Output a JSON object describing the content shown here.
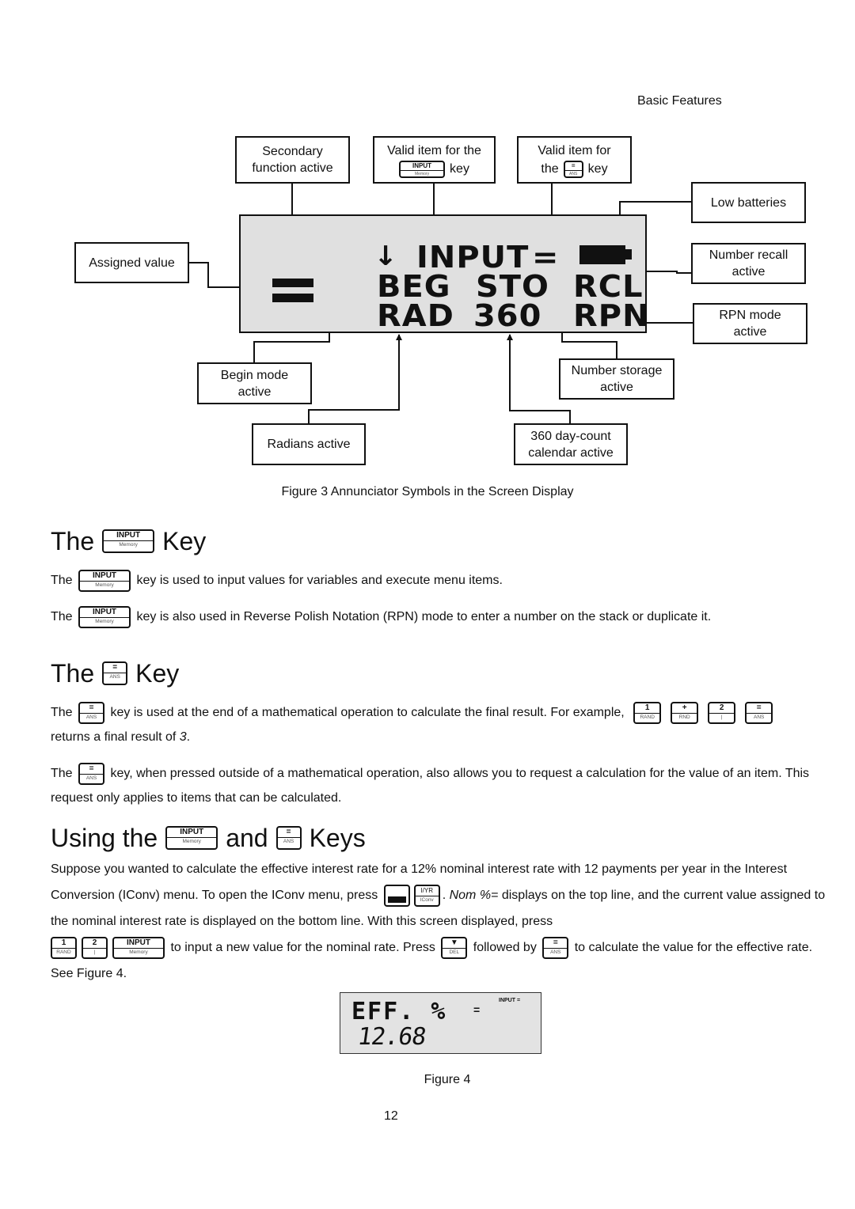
{
  "running_head": "Basic Features",
  "figure3": {
    "callouts": {
      "secondary": [
        "Secondary",
        "function active"
      ],
      "valid_input": {
        "line1": "Valid item for the",
        "suffix": "key"
      },
      "valid_equals": {
        "line1": "Valid item for",
        "prefix": "the",
        "suffix": "key"
      },
      "low_batteries": "Low batteries",
      "assigned_value": "Assigned value",
      "number_recall": [
        "Number recall",
        "active"
      ],
      "rpn_mode": [
        "RPN mode",
        "active"
      ],
      "begin_mode": [
        "Begin mode",
        "active"
      ],
      "number_storage": [
        "Number storage",
        "active"
      ],
      "radians": "Radians active",
      "day360": [
        "360 day-count",
        "calendar active"
      ]
    },
    "lcd": {
      "row1": {
        "arrow": "↓",
        "input": "INPUT",
        "equals": "="
      },
      "row2": {
        "beg": "BEG",
        "sto": "STO",
        "rcl": "RCL"
      },
      "row3": {
        "rad": "RAD",
        "n360": "360",
        "rpn": "RPN"
      }
    },
    "caption": "Figure 3 Annunciator Symbols in the Screen Display"
  },
  "keys": {
    "input": {
      "top": "INPUT",
      "bottom": "Memory"
    },
    "equals": {
      "top": "=",
      "bottom": "ANS"
    },
    "one": {
      "top": "1",
      "bottom": "RAND"
    },
    "plus": {
      "top": "+",
      "bottom": "RND"
    },
    "two": {
      "top": "2",
      "bottom": "|"
    },
    "iyr": {
      "top": "I/YR",
      "bottom": "IConv"
    },
    "down": {
      "top": "▼",
      "bottom": "DEL"
    }
  },
  "section1": {
    "heading_pre": "The",
    "heading_post": "Key",
    "p1_pre": "The",
    "p1_post": "key is used to input values for variables and execute menu items.",
    "p2_pre": "The",
    "p2_post": "key is also used in Reverse Polish Notation (RPN) mode to enter a number on the stack or duplicate it."
  },
  "section2": {
    "heading_pre": "The",
    "heading_post": "Key",
    "p1_pre": "The",
    "p1_mid": "key is used at the end of a mathematical operation to calculate the final result. For example,",
    "p1_line2": "returns a final result of",
    "p1_result": "3",
    "p1_end": ".",
    "p2_pre": "The",
    "p2_post": "key, when pressed outside of a mathematical operation, also allows you to request a calculation for the value of an item. This request only applies to items that can be calculated."
  },
  "section3": {
    "heading_pre": "Using the",
    "heading_mid": "and",
    "heading_post": "Keys",
    "p_a": "Suppose you wanted to calculate the effective interest rate for a 12% nominal interest rate with 12 payments per year in the Interest Conversion (IConv) menu. To open the IConv menu, press",
    "p_b_italic": "Nom %=",
    "p_b": "displays on the top line, and the current value assigned to the nominal interest rate is displayed on the bottom line. With this screen displayed, press",
    "p_c": "to input a new value for the nominal rate. Press",
    "p_d": "followed by",
    "p_e": "to calculate the value for the effective rate. See Figure 4."
  },
  "figure4": {
    "line1": "EFF. %",
    "equals": "=",
    "annunciator": "INPUT =",
    "line2": "12.68",
    "caption": "Figure 4"
  },
  "page_number": "12"
}
